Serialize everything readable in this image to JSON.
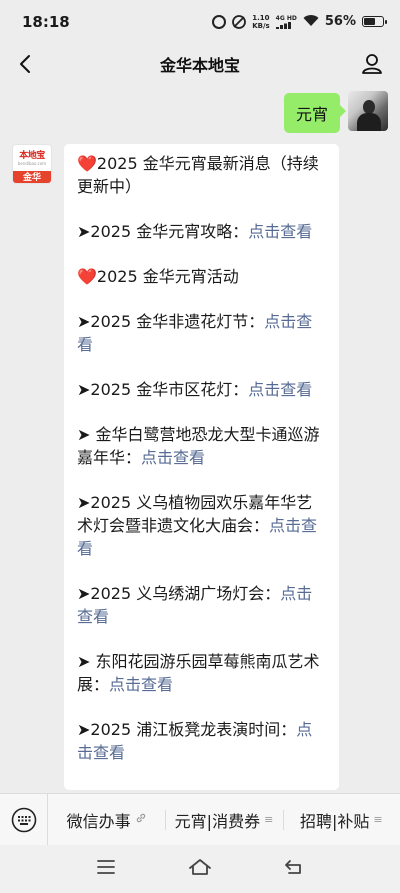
{
  "status_bar": {
    "time": "18:18",
    "net_speed_value": "1.10",
    "net_speed_unit": "KB/s",
    "network_type": "4G HD",
    "battery_percent": "56%",
    "battery_level": 0.56,
    "icons": [
      "alarm-icon",
      "mute-icon",
      "signal-icon",
      "wifi-icon",
      "battery-icon"
    ]
  },
  "nav": {
    "title": "金华本地宝",
    "back_icon": "chevron-left-icon",
    "profile_icon": "person-icon"
  },
  "user_message": {
    "text": "元宵"
  },
  "bot": {
    "avatar_logo_text": "本地宝",
    "avatar_logo_url": "bendibao.com",
    "avatar_city": "金华"
  },
  "reply": {
    "items": [
      {
        "prefix": "❤️",
        "text": "2025 金华元宵最新消息（持续更新中）",
        "link": ""
      },
      {
        "prefix": "➤",
        "text": "2025 金华元宵攻略：",
        "link": "点击查看"
      },
      {
        "prefix": "❤️",
        "text": "2025 金华元宵活动",
        "link": ""
      },
      {
        "prefix": "➤",
        "text": "2025 金华非遗花灯节：",
        "link": "点击查看"
      },
      {
        "prefix": "➤",
        "text": "2025 金华市区花灯：",
        "link": "点击查看"
      },
      {
        "prefix": "➤",
        "text": " 金华白鹭营地恐龙大型卡通巡游嘉年华：",
        "link": "点击查看"
      },
      {
        "prefix": "➤",
        "text": "2025 义乌植物园欢乐嘉年华艺术灯会暨非遗文化大庙会：",
        "link": "点击查看"
      },
      {
        "prefix": "➤",
        "text": "2025 义乌绣湖广场灯会：",
        "link": "点击查看"
      },
      {
        "prefix": "➤",
        "text": " 东阳花园游乐园草莓熊南瓜艺术展：",
        "link": "点击查看"
      },
      {
        "prefix": "➤",
        "text": "2025 浦江板凳龙表演时间：",
        "link": "点击查看"
      }
    ]
  },
  "menu": {
    "keyboard_icon": "keyboard-icon",
    "items": [
      {
        "label": "微信办事",
        "suffix_icon": "link-icon"
      },
      {
        "label": "元宵|消费券",
        "suffix": "≡"
      },
      {
        "label": "招聘|补贴",
        "suffix": "≡"
      }
    ]
  },
  "system_nav": {
    "icons": [
      "menu-icon",
      "home-icon",
      "back-icon"
    ]
  },
  "colors": {
    "background": "#ededed",
    "green_bubble": "#95ec69",
    "link": "#576b95",
    "heart": "#e8342a",
    "brand_red": "#e5432c"
  }
}
